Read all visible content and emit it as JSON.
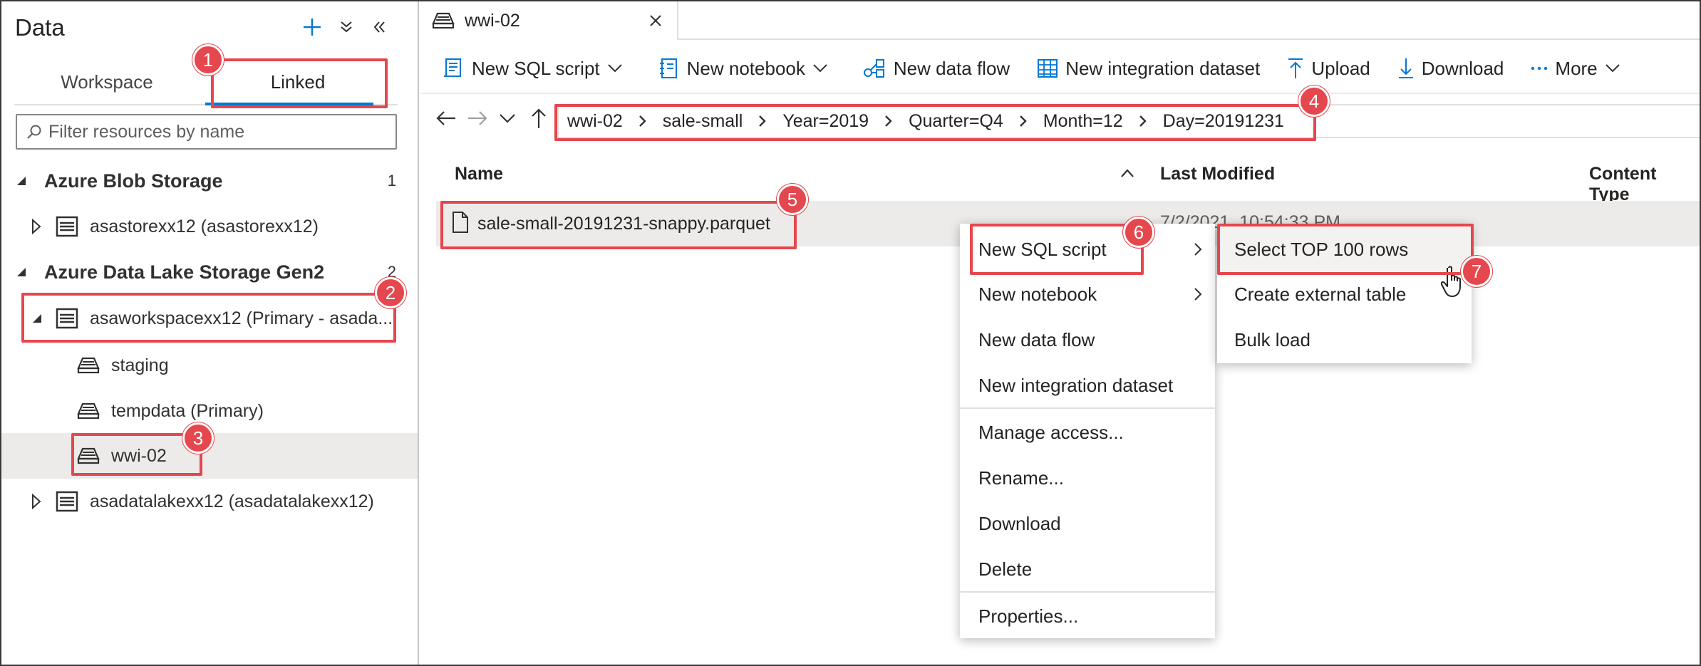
{
  "left_panel": {
    "title": "Data",
    "tabs": [
      {
        "label": "Workspace",
        "active": false
      },
      {
        "label": "Linked",
        "active": true
      }
    ],
    "filter_placeholder": "Filter resources by name",
    "sections": [
      {
        "label": "Azure Blob Storage",
        "count": "1",
        "items": [
          {
            "label": "asastorexx12 (asastorexx12)"
          }
        ]
      },
      {
        "label": "Azure Data Lake Storage Gen2",
        "count": "2",
        "items": [
          {
            "label": "asaworkspacexx12 (Primary - asada...",
            "children": [
              {
                "label": "staging"
              },
              {
                "label": "tempdata (Primary)"
              },
              {
                "label": "wwi-02",
                "selected": true
              }
            ]
          },
          {
            "label": "asadatalakexx12 (asadatalakexx12)"
          }
        ]
      }
    ]
  },
  "document_tab": {
    "label": "wwi-02"
  },
  "toolbar": {
    "new_sql_script": "New SQL script",
    "new_notebook": "New notebook",
    "new_data_flow": "New data flow",
    "new_integration_dataset": "New integration dataset",
    "upload": "Upload",
    "download": "Download",
    "more": "More"
  },
  "breadcrumb": [
    "wwi-02",
    "sale-small",
    "Year=2019",
    "Quarter=Q4",
    "Month=12",
    "Day=20191231"
  ],
  "file_list": {
    "columns": {
      "name": "Name",
      "last_modified": "Last Modified",
      "content_type": "Content Type"
    },
    "rows": [
      {
        "name": "sale-small-20191231-snappy.parquet",
        "last_modified": "7/2/2021, 10:54:33 PM"
      }
    ]
  },
  "context_menu": {
    "items": [
      {
        "label": "New SQL script",
        "submenu": true
      },
      {
        "label": "New notebook",
        "submenu": true
      },
      {
        "label": "New data flow"
      },
      {
        "label": "New integration dataset"
      },
      {
        "label": "Manage access..."
      },
      {
        "label": "Rename..."
      },
      {
        "label": "Download"
      },
      {
        "label": "Delete"
      },
      {
        "label": "Properties..."
      }
    ]
  },
  "submenu": {
    "items": [
      {
        "label": "Select TOP 100 rows",
        "hover": true
      },
      {
        "label": "Create external table"
      },
      {
        "label": "Bulk load"
      }
    ]
  },
  "annotations": [
    "1",
    "2",
    "3",
    "4",
    "5",
    "6",
    "7"
  ],
  "colors": {
    "accent": "#0078d4",
    "annotation": "#e5474e",
    "selected_row": "#edebe9"
  }
}
